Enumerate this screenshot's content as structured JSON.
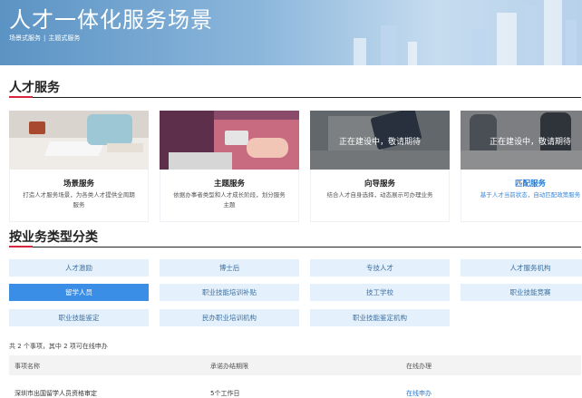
{
  "banner": {
    "title": "人才一体化服务场景",
    "links": [
      "场景式服务",
      "主题式服务"
    ],
    "separator": "|"
  },
  "talent_services": {
    "title": "人才服务",
    "cards": [
      {
        "name": "场景服务",
        "desc": "打造人才服务场景，为各类人才提供全周期服务",
        "cover": "",
        "image": "desk-with-laptop-and-tea"
      },
      {
        "name": "主题服务",
        "desc": "依据办事者类型和人才成长阶段，划分服务主题",
        "cover": "",
        "image": "hand-holding-card"
      },
      {
        "name": "向导服务",
        "desc": "结合人才自身选择，动态展示可办理业务",
        "cover": "正在建设中，敬请期待",
        "image": "tablet-and-papers"
      },
      {
        "name": "匹配服务",
        "desc": "基于人才当前状态，自动匹配政策服务",
        "cover": "正在建设中，敬请期待",
        "image": "office-people"
      }
    ]
  },
  "categories": {
    "title": "按业务类型分类",
    "items": [
      "人才激励",
      "博士后",
      "专技人才",
      "人才服务机构",
      "留学人员",
      "职业技能培训补贴",
      "技工学校",
      "职业技能竞赛",
      "职业技能鉴定",
      "民办职业培训机构",
      "职业技能鉴定机构"
    ],
    "active": "留学人员"
  },
  "summary": "共 2 个事项，其中 2 项可在线申办",
  "table": {
    "headers": [
      "事项名称",
      "承诺办结期限",
      "在线办理"
    ],
    "rows": [
      {
        "name": "深圳市出国留学人员资格审定",
        "deadline": "5个工作日",
        "action": "在线申办"
      }
    ]
  },
  "colors": {
    "accent_red": "#d7263d",
    "button_bg": "#e4f1fd",
    "active_button": "#3b8ee5",
    "link": "#1f7ad6"
  }
}
